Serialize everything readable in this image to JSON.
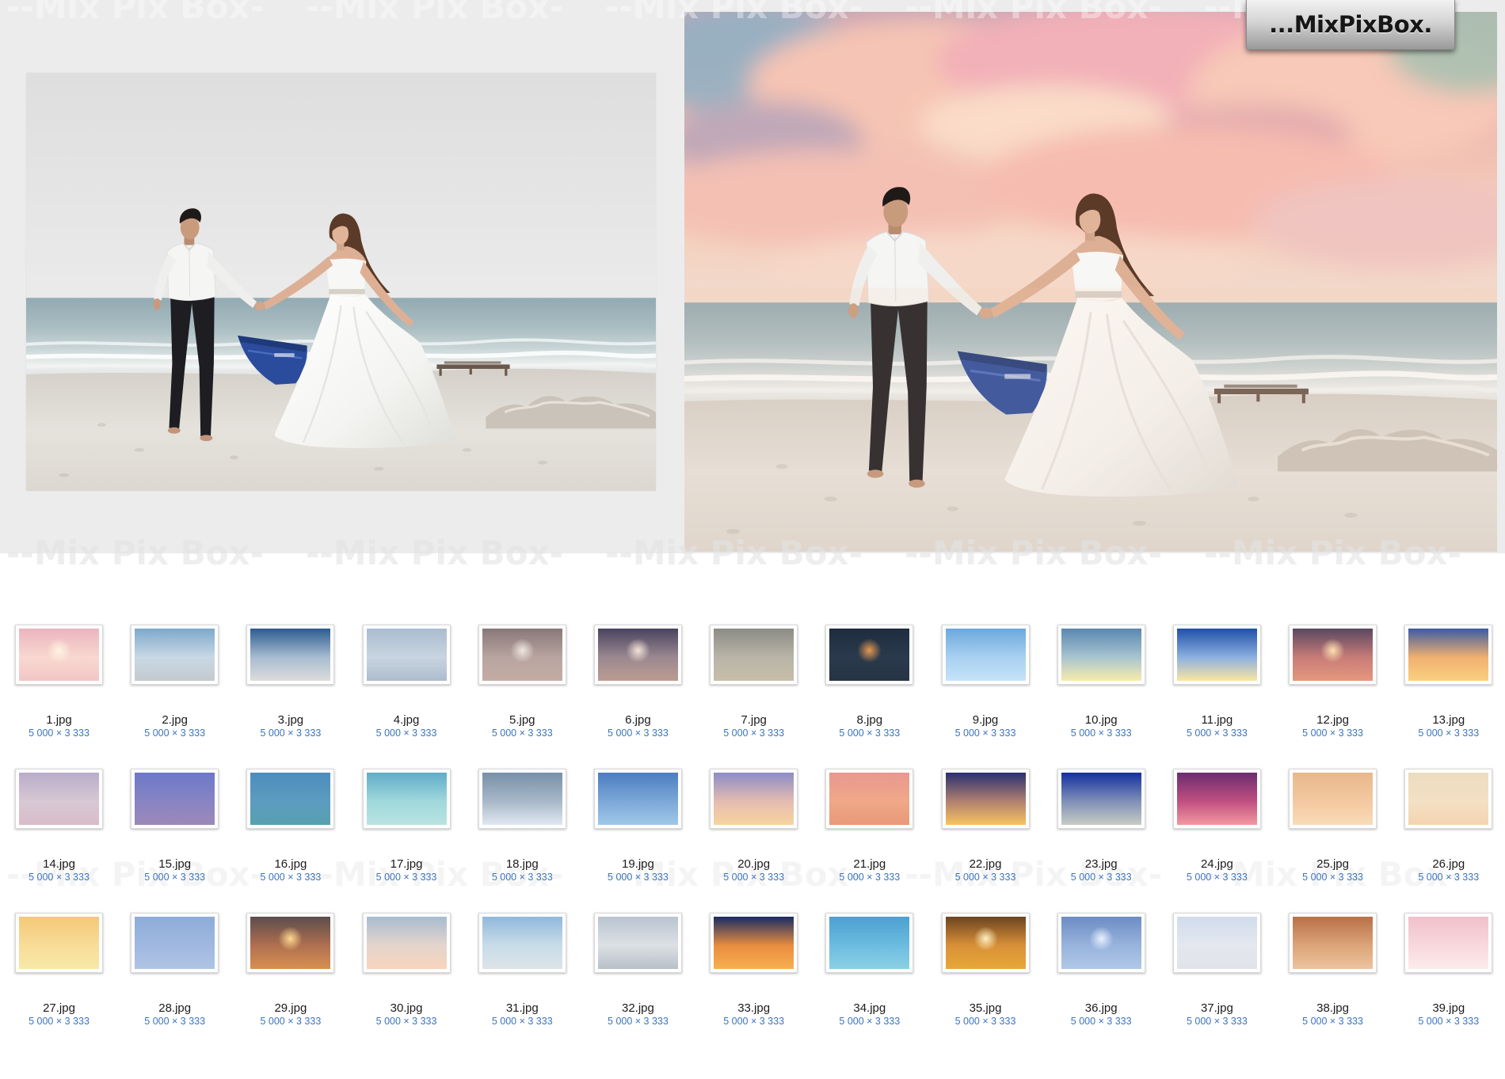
{
  "brand": {
    "logo_text": "...MixPixBox.",
    "watermark": "--Mix Pix Box-"
  },
  "thumbnails": [
    {
      "name": "1.jpg",
      "dims": "5 000 × 3 333",
      "sky": [
        "#eab4be",
        "#f8d8d0",
        "#f2c6c6"
      ],
      "glow": "#fff4e4"
    },
    {
      "name": "2.jpg",
      "dims": "5 000 × 3 333",
      "sky": [
        "#7ea8cc",
        "#c8d8e4",
        "#c4cacd"
      ]
    },
    {
      "name": "3.jpg",
      "dims": "5 000 × 3 333",
      "sky": [
        "#2c5c90",
        "#a8bcd0",
        "#dcdcdc"
      ]
    },
    {
      "name": "4.jpg",
      "dims": "5 000 × 3 333",
      "sky": [
        "#aabcd0",
        "#c8d4e0",
        "#aebccc"
      ]
    },
    {
      "name": "5.jpg",
      "dims": "5 000 × 3 333",
      "sky": [
        "#887878",
        "#b8a4a0",
        "#c4aca4"
      ],
      "glow": "#f0e8e0"
    },
    {
      "name": "6.jpg",
      "dims": "5 000 × 3 333",
      "sky": [
        "#4a4460",
        "#9a8890",
        "#bc9c90"
      ],
      "glow": "#f4e4d8"
    },
    {
      "name": "7.jpg",
      "dims": "5 000 × 3 333",
      "sky": [
        "#8c8c84",
        "#b8b4a8",
        "#c8bea8"
      ]
    },
    {
      "name": "8.jpg",
      "dims": "5 000 × 3 333",
      "sky": [
        "#1e2c3e",
        "#2a3a4c",
        "#263444"
      ],
      "glow": "#e89850"
    },
    {
      "name": "9.jpg",
      "dims": "5 000 × 3 333",
      "sky": [
        "#6ca8dc",
        "#a8d0f0",
        "#c4e4f8"
      ]
    },
    {
      "name": "10.jpg",
      "dims": "5 000 × 3 333",
      "sky": [
        "#5a88b0",
        "#a8c4d0",
        "#f8ecac"
      ]
    },
    {
      "name": "11.jpg",
      "dims": "5 000 × 3 333",
      "sky": [
        "#2050a8",
        "#8cb0e0",
        "#fbe6a0"
      ]
    },
    {
      "name": "12.jpg",
      "dims": "5 000 × 3 333",
      "sky": [
        "#5a4860",
        "#c87c78",
        "#e4987c"
      ],
      "glow": "#ffe0b0"
    },
    {
      "name": "13.jpg",
      "dims": "5 000 × 3 333",
      "sky": [
        "#3c5ca4",
        "#f0b070",
        "#fad080"
      ]
    },
    {
      "name": "14.jpg",
      "dims": "5 000 × 3 333",
      "sky": [
        "#b8acc8",
        "#d8c8d4",
        "#d8bcc8"
      ]
    },
    {
      "name": "15.jpg",
      "dims": "5 000 × 3 333",
      "sky": [
        "#6c78c8",
        "#8884c4",
        "#9c88b8"
      ]
    },
    {
      "name": "16.jpg",
      "dims": "5 000 × 3 333",
      "sky": [
        "#4c8cbc",
        "#5c9cc0",
        "#58a0b0"
      ]
    },
    {
      "name": "17.jpg",
      "dims": "5 000 × 3 333",
      "sky": [
        "#60acc8",
        "#a0d8dc",
        "#b8e4e0"
      ]
    },
    {
      "name": "18.jpg",
      "dims": "5 000 × 3 333",
      "sky": [
        "#7890a8",
        "#a8b8c8",
        "#e0e8f0"
      ]
    },
    {
      "name": "19.jpg",
      "dims": "5 000 × 3 333",
      "sky": [
        "#4c7cc0",
        "#7ca8d8",
        "#a0c8e8"
      ]
    },
    {
      "name": "20.jpg",
      "dims": "5 000 × 3 333",
      "sky": [
        "#8c8cc8",
        "#e4bcb0",
        "#f8d4a0"
      ]
    },
    {
      "name": "21.jpg",
      "dims": "5 000 × 3 333",
      "sky": [
        "#e89890",
        "#f0a888",
        "#e89878"
      ]
    },
    {
      "name": "22.jpg",
      "dims": "5 000 × 3 333",
      "sky": [
        "#283070",
        "#b08070",
        "#f8c460"
      ]
    },
    {
      "name": "23.jpg",
      "dims": "5 000 × 3 333",
      "sky": [
        "#1430a0",
        "#8090b8",
        "#c8ccc4"
      ]
    },
    {
      "name": "24.jpg",
      "dims": "5 000 × 3 333",
      "sky": [
        "#6c2c70",
        "#c05080",
        "#f498a0"
      ]
    },
    {
      "name": "25.jpg",
      "dims": "5 000 × 3 333",
      "sky": [
        "#e8b88c",
        "#f4c8a0",
        "#f8dcb8"
      ]
    },
    {
      "name": "26.jpg",
      "dims": "5 000 × 3 333",
      "sky": [
        "#ecdcc0",
        "#f4e0c4",
        "#f4d4b0"
      ]
    },
    {
      "name": "27.jpg",
      "dims": "5 000 × 3 333",
      "sky": [
        "#f4c878",
        "#f8dc98",
        "#f8e8a8"
      ]
    },
    {
      "name": "28.jpg",
      "dims": "5 000 × 3 333",
      "sky": [
        "#8cacd8",
        "#a0b8e0",
        "#b0c4e4"
      ]
    },
    {
      "name": "29.jpg",
      "dims": "5 000 × 3 333",
      "sky": [
        "#5c4c4c",
        "#b07050",
        "#d89050"
      ],
      "glow": "#ffd890"
    },
    {
      "name": "30.jpg",
      "dims": "5 000 × 3 333",
      "sky": [
        "#a8bcd0",
        "#e4d4cc",
        "#f8d4bc"
      ]
    },
    {
      "name": "31.jpg",
      "dims": "5 000 × 3 333",
      "sky": [
        "#90b8dc",
        "#c8dce8",
        "#dce4e8"
      ]
    },
    {
      "name": "32.jpg",
      "dims": "5 000 × 3 333",
      "sky": [
        "#b8c4d0",
        "#dce0e4",
        "#b8c0c8"
      ]
    },
    {
      "name": "33.jpg",
      "dims": "5 000 × 3 333",
      "sky": [
        "#182c64",
        "#e88c40",
        "#f8b050"
      ]
    },
    {
      "name": "34.jpg",
      "dims": "5 000 × 3 333",
      "sky": [
        "#4ca0d0",
        "#6cbce0",
        "#8cd0e4"
      ]
    },
    {
      "name": "35.jpg",
      "dims": "5 000 × 3 333",
      "sky": [
        "#6c4420",
        "#d89038",
        "#e8a838"
      ],
      "glow": "#fff0c0"
    },
    {
      "name": "36.jpg",
      "dims": "5 000 × 3 333",
      "sky": [
        "#6c8cc4",
        "#98b4dc",
        "#b0c8e8"
      ],
      "glow": "#e8f0ff"
    },
    {
      "name": "37.jpg",
      "dims": "5 000 × 3 333",
      "sky": [
        "#d0dcec",
        "#e4e8ee",
        "#e0e4ea"
      ]
    },
    {
      "name": "38.jpg",
      "dims": "5 000 × 3 333",
      "sky": [
        "#b87048",
        "#dca478",
        "#ecc4a0"
      ]
    },
    {
      "name": "39.jpg",
      "dims": "5 000 × 3 333",
      "sky": [
        "#f0c0cc",
        "#f8d8dc",
        "#fcecec"
      ]
    }
  ]
}
